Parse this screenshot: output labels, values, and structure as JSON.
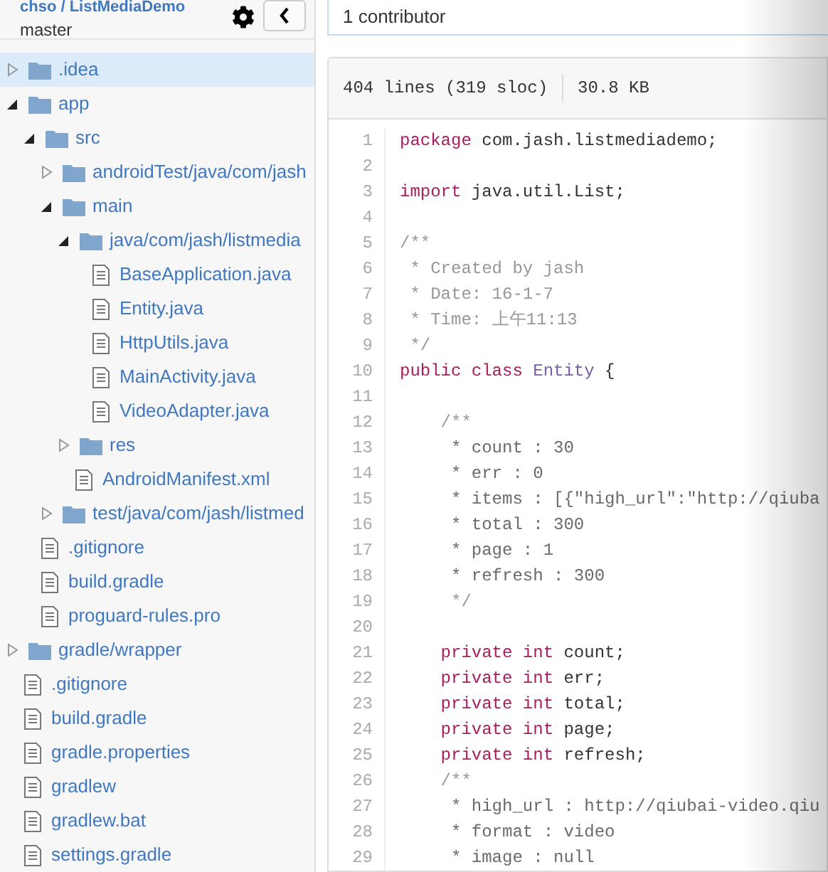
{
  "repo": {
    "title": "chso / ListMediaDemo",
    "branch": "master"
  },
  "tree": [
    {
      "kind": "folder",
      "name": ".idea",
      "expanded": false,
      "selected": true
    },
    {
      "kind": "folder",
      "name": "app",
      "expanded": true,
      "selected": false,
      "children": [
        {
          "kind": "folder",
          "name": "src",
          "expanded": true,
          "selected": false,
          "children": [
            {
              "kind": "folder",
              "name": "androidTest/java/com/jash",
              "expanded": false,
              "selected": false
            },
            {
              "kind": "folder",
              "name": "main",
              "expanded": true,
              "selected": false,
              "children": [
                {
                  "kind": "folder",
                  "name": "java/com/jash/listmedia",
                  "expanded": true,
                  "selected": false,
                  "children": [
                    {
                      "kind": "file",
                      "name": "BaseApplication.java",
                      "selected": false
                    },
                    {
                      "kind": "file",
                      "name": "Entity.java",
                      "selected": false
                    },
                    {
                      "kind": "file",
                      "name": "HttpUtils.java",
                      "selected": false
                    },
                    {
                      "kind": "file",
                      "name": "MainActivity.java",
                      "selected": false
                    },
                    {
                      "kind": "file",
                      "name": "VideoAdapter.java",
                      "selected": false
                    }
                  ]
                },
                {
                  "kind": "folder",
                  "name": "res",
                  "expanded": false,
                  "selected": false
                },
                {
                  "kind": "file",
                  "name": "AndroidManifest.xml",
                  "selected": false
                }
              ]
            },
            {
              "kind": "folder",
              "name": "test/java/com/jash/listmed",
              "expanded": false,
              "selected": false
            }
          ]
        },
        {
          "kind": "file",
          "name": ".gitignore",
          "selected": false
        },
        {
          "kind": "file",
          "name": "build.gradle",
          "selected": false
        },
        {
          "kind": "file",
          "name": "proguard-rules.pro",
          "selected": false
        }
      ]
    },
    {
      "kind": "folder",
      "name": "gradle/wrapper",
      "expanded": false,
      "selected": false
    },
    {
      "kind": "file",
      "name": ".gitignore",
      "selected": false
    },
    {
      "kind": "file",
      "name": "build.gradle",
      "selected": false
    },
    {
      "kind": "file",
      "name": "gradle.properties",
      "selected": false
    },
    {
      "kind": "file",
      "name": "gradlew",
      "selected": false
    },
    {
      "kind": "file",
      "name": "gradlew.bat",
      "selected": false
    },
    {
      "kind": "file",
      "name": "settings.gradle",
      "selected": false
    }
  ],
  "contributors": "1 contributor",
  "file_info": {
    "lines": "404 lines (319 sloc)",
    "size": "30.8 KB"
  },
  "code": [
    {
      "number": "1",
      "tokens": [
        {
          "kind": "keyword",
          "text": "package"
        },
        {
          "kind": "plain",
          "text": " com.jash.listmediademo;"
        }
      ]
    },
    {
      "number": "2"
    },
    {
      "number": "3",
      "tokens": [
        {
          "kind": "keyword",
          "text": "import"
        },
        {
          "kind": "plain",
          "text": " java.util.List;"
        }
      ]
    },
    {
      "number": "4"
    },
    {
      "number": "5",
      "tokens": [
        {
          "kind": "comment",
          "text": "/**"
        }
      ]
    },
    {
      "number": "6",
      "tokens": [
        {
          "kind": "comment",
          "text": " * Created by jash"
        }
      ]
    },
    {
      "number": "7",
      "tokens": [
        {
          "kind": "comment",
          "text": " * Date: 16-1-7"
        }
      ]
    },
    {
      "number": "8",
      "tokens": [
        {
          "kind": "comment",
          "text": " * Time: 上午11:13"
        }
      ]
    },
    {
      "number": "9",
      "tokens": [
        {
          "kind": "comment",
          "text": " */"
        }
      ]
    },
    {
      "number": "10",
      "tokens": [
        {
          "kind": "keyword",
          "text": "public class"
        },
        {
          "kind": "type",
          "text": " Entity"
        },
        {
          "kind": "plain",
          "text": " {"
        }
      ]
    },
    {
      "number": "11"
    },
    {
      "number": "12",
      "tokens": [
        {
          "kind": "comment",
          "text": "    /**"
        }
      ]
    },
    {
      "number": "13",
      "tokens": [
        {
          "kind": "doc",
          "text": "     * count : 30"
        }
      ]
    },
    {
      "number": "14",
      "tokens": [
        {
          "kind": "doc",
          "text": "     * err : 0"
        }
      ]
    },
    {
      "number": "15",
      "tokens": [
        {
          "kind": "doc",
          "text": "     * items : [{\"high_url\":\"http://qiuba"
        }
      ]
    },
    {
      "number": "16",
      "tokens": [
        {
          "kind": "doc",
          "text": "     * total : 300"
        }
      ]
    },
    {
      "number": "17",
      "tokens": [
        {
          "kind": "doc",
          "text": "     * page : 1"
        }
      ]
    },
    {
      "number": "18",
      "tokens": [
        {
          "kind": "doc",
          "text": "     * refresh : 300"
        }
      ]
    },
    {
      "number": "19",
      "tokens": [
        {
          "kind": "comment",
          "text": "     */"
        }
      ]
    },
    {
      "number": "20"
    },
    {
      "number": "21",
      "tokens": [
        {
          "kind": "keyword",
          "text": "    private int"
        },
        {
          "kind": "plain",
          "text": " count;"
        }
      ]
    },
    {
      "number": "22",
      "tokens": [
        {
          "kind": "keyword",
          "text": "    private int"
        },
        {
          "kind": "plain",
          "text": " err;"
        }
      ]
    },
    {
      "number": "23",
      "tokens": [
        {
          "kind": "keyword",
          "text": "    private int"
        },
        {
          "kind": "plain",
          "text": " total;"
        }
      ]
    },
    {
      "number": "24",
      "tokens": [
        {
          "kind": "keyword",
          "text": "    private int"
        },
        {
          "kind": "plain",
          "text": " page;"
        }
      ]
    },
    {
      "number": "25",
      "tokens": [
        {
          "kind": "keyword",
          "text": "    private int"
        },
        {
          "kind": "plain",
          "text": " refresh;"
        }
      ]
    },
    {
      "number": "26",
      "tokens": [
        {
          "kind": "comment",
          "text": "    /**"
        }
      ]
    },
    {
      "number": "27",
      "tokens": [
        {
          "kind": "doc",
          "text": "     * high_url : http://qiubai-video.qiu"
        }
      ]
    },
    {
      "number": "28",
      "tokens": [
        {
          "kind": "doc",
          "text": "     * format : video"
        }
      ]
    },
    {
      "number": "29",
      "tokens": [
        {
          "kind": "doc",
          "text": "     * image : null"
        }
      ]
    }
  ]
}
